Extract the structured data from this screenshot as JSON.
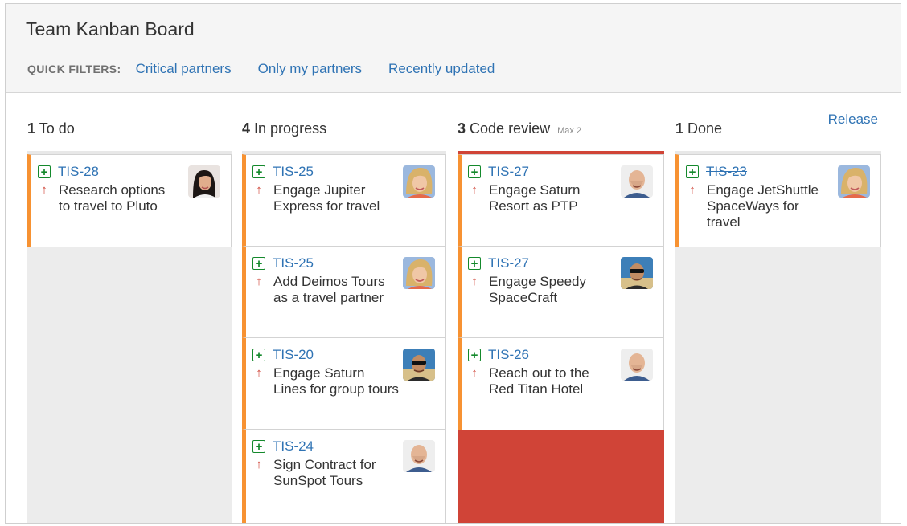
{
  "board": {
    "title": "Team Kanban Board",
    "quick_filters_label": "QUICK FILTERS:",
    "quick_filters": [
      "Critical partners",
      "Only my partners",
      "Recently updated"
    ],
    "release_label": "Release"
  },
  "columns": [
    {
      "count": "1",
      "name": "To do",
      "max": ""
    },
    {
      "count": "4",
      "name": "In progress",
      "max": ""
    },
    {
      "count": "3",
      "name": "Code review",
      "max": "Max 2"
    },
    {
      "count": "1",
      "name": "Done",
      "max": ""
    }
  ],
  "cards": {
    "todo": [
      {
        "key": "TIS-28",
        "summary": "Research options\nto travel to Pluto",
        "avatar": "woman-dark-hair-avatar"
      }
    ],
    "in_progress": [
      {
        "key": "TIS-25",
        "summary": "Engage Jupiter\nExpress for travel",
        "avatar": "woman-blonde-avatar"
      },
      {
        "key": "TIS-25",
        "summary": "Add Deimos Tours\nas a travel partner",
        "avatar": "woman-blonde-avatar"
      },
      {
        "key": "TIS-20",
        "summary": "Engage Saturn\nLines for group tours",
        "avatar": "man-sunglasses-avatar"
      },
      {
        "key": "TIS-24",
        "summary": "Sign Contract for\nSunSpot Tours",
        "avatar": "man-bald-avatar"
      }
    ],
    "code_review": [
      {
        "key": "TIS-27",
        "summary": "Engage Saturn\nResort as PTP",
        "avatar": "man-bald-avatar"
      },
      {
        "key": "TIS-27",
        "summary": "Engage Speedy\nSpaceCraft",
        "avatar": "man-sunglasses-avatar"
      },
      {
        "key": "TIS-26",
        "summary": "Reach out to the\nRed Titan Hotel",
        "avatar": "man-bald-avatar"
      }
    ],
    "done": [
      {
        "key": "TIS-23",
        "summary": "Engage JetShuttle\nSpaceWays for\ntravel",
        "avatar": "woman-blonde-avatar"
      }
    ]
  },
  "icons": {
    "issue_type": "story-plus-icon",
    "priority": "priority-up-arrow-icon"
  },
  "colors": {
    "link": "#2f73b4",
    "in_progress_accent": "#f79232",
    "over_limit": "#d04437",
    "issue_type": "#14892c",
    "priority": "#d04437"
  }
}
